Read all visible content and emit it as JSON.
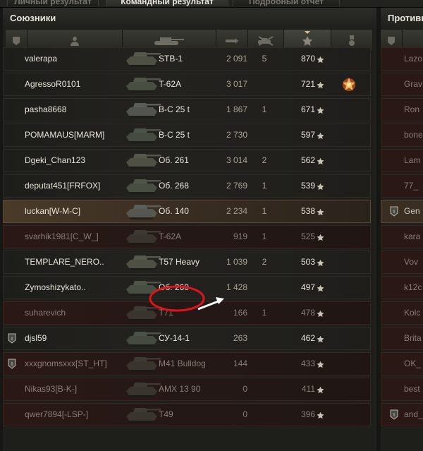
{
  "tabs": [
    {
      "label": "Личный результат",
      "active": false
    },
    {
      "label": "Командный результат",
      "active": true
    },
    {
      "label": "Подробный отчет",
      "active": false
    }
  ],
  "left_panel": {
    "title": "Союзники",
    "columns": [
      "squad-icon",
      "player-icon",
      "tank-icon",
      "damage-icon",
      "frags-icon",
      "experience-star-icon",
      "medal-icon"
    ],
    "sorted_column": "experience-star-icon",
    "rows": [
      {
        "name": "valerapa",
        "tank": "STB-1",
        "damage": "2 091",
        "kills": "5",
        "xp": "870",
        "state": "alive",
        "platoon": "",
        "medal": false
      },
      {
        "name": "AgressoR0101",
        "tank": "T-62A",
        "damage": "3 017",
        "kills": "",
        "xp": "721",
        "state": "alive",
        "platoon": "",
        "medal": true
      },
      {
        "name": "pasha8668",
        "tank": "B-C 25 t",
        "damage": "1 867",
        "kills": "1",
        "xp": "671",
        "state": "alive",
        "platoon": "",
        "medal": false
      },
      {
        "name": "POMAMAUS[MARM]",
        "tank": "B-C 25 t",
        "damage": "2 730",
        "kills": "",
        "xp": "597",
        "state": "alive",
        "platoon": "",
        "medal": false
      },
      {
        "name": "Dgeki_Chan123",
        "tank": "Об. 261",
        "damage": "3 014",
        "kills": "2",
        "xp": "562",
        "state": "alive",
        "platoon": "",
        "medal": false
      },
      {
        "name": "deputat451[FRFOX]",
        "tank": "Об. 268",
        "damage": "2 769",
        "kills": "1",
        "xp": "539",
        "state": "alive",
        "platoon": "",
        "medal": false
      },
      {
        "name": "luckan[W-M-C]",
        "tank": "Об. 140",
        "damage": "2 234",
        "kills": "1",
        "xp": "538",
        "state": "player",
        "platoon": "",
        "medal": false
      },
      {
        "name": "svarhik1981[C_W_]",
        "tank": "T-62A",
        "damage": "919",
        "kills": "1",
        "xp": "525",
        "state": "dead",
        "platoon": "",
        "medal": false
      },
      {
        "name": "TEMPLARE_NERO..",
        "tank": "T57 Heavy",
        "damage": "1 039",
        "kills": "2",
        "xp": "503",
        "state": "alive",
        "platoon": "",
        "medal": false
      },
      {
        "name": "Zymoshizykato..",
        "tank": "Об. 260",
        "damage": "1 428",
        "kills": "",
        "xp": "497",
        "state": "alive",
        "platoon": "",
        "medal": false
      },
      {
        "name": "suharevich",
        "tank": "T71",
        "damage": "166",
        "kills": "1",
        "xp": "478",
        "state": "dead",
        "platoon": "",
        "medal": false
      },
      {
        "name": "djsl59",
        "tank": "СУ-14-1",
        "damage": "263",
        "kills": "",
        "xp": "462",
        "state": "alive",
        "platoon": "I",
        "medal": false
      },
      {
        "name": "xxxgnomsxxx[ST_HT]",
        "tank": "M41 Bulldog",
        "damage": "144",
        "kills": "",
        "xp": "433",
        "state": "dead",
        "platoon": "I",
        "medal": false
      },
      {
        "name": "Nikas93[B-K-]",
        "tank": "AMX 13 90",
        "damage": "0",
        "kills": "",
        "xp": "411",
        "state": "dead",
        "platoon": "",
        "medal": false
      },
      {
        "name": "qwer7894[-LSP-]",
        "tank": "T49",
        "damage": "0",
        "kills": "",
        "xp": "396",
        "state": "dead",
        "platoon": "",
        "medal": false
      }
    ]
  },
  "right_panel": {
    "title": "Противн",
    "rows": [
      {
        "name": "Lazo",
        "state": "dead",
        "platoon": ""
      },
      {
        "name": "Grav",
        "state": "dead",
        "platoon": ""
      },
      {
        "name": "Ron",
        "state": "dead",
        "platoon": ""
      },
      {
        "name": "bone",
        "state": "dead",
        "platoon": ""
      },
      {
        "name": "Lam",
        "state": "dead",
        "platoon": ""
      },
      {
        "name": "77_",
        "state": "dead",
        "platoon": ""
      },
      {
        "name": "Gen",
        "state": "player",
        "platoon": "I"
      },
      {
        "name": "kara",
        "state": "dead",
        "platoon": ""
      },
      {
        "name": "Vov",
        "state": "dead",
        "platoon": ""
      },
      {
        "name": "k12c",
        "state": "dead",
        "platoon": ""
      },
      {
        "name": "Kolc",
        "state": "dead",
        "platoon": ""
      },
      {
        "name": "Brita",
        "state": "dead",
        "platoon": ""
      },
      {
        "name": "OK_",
        "state": "dead",
        "platoon": ""
      },
      {
        "name": "best",
        "state": "dead",
        "platoon": ""
      },
      {
        "name": "and_",
        "state": "dead",
        "platoon": "I"
      }
    ]
  },
  "annotation": {
    "color": "#e0141a",
    "highlighted_tank": "Об. 260"
  }
}
